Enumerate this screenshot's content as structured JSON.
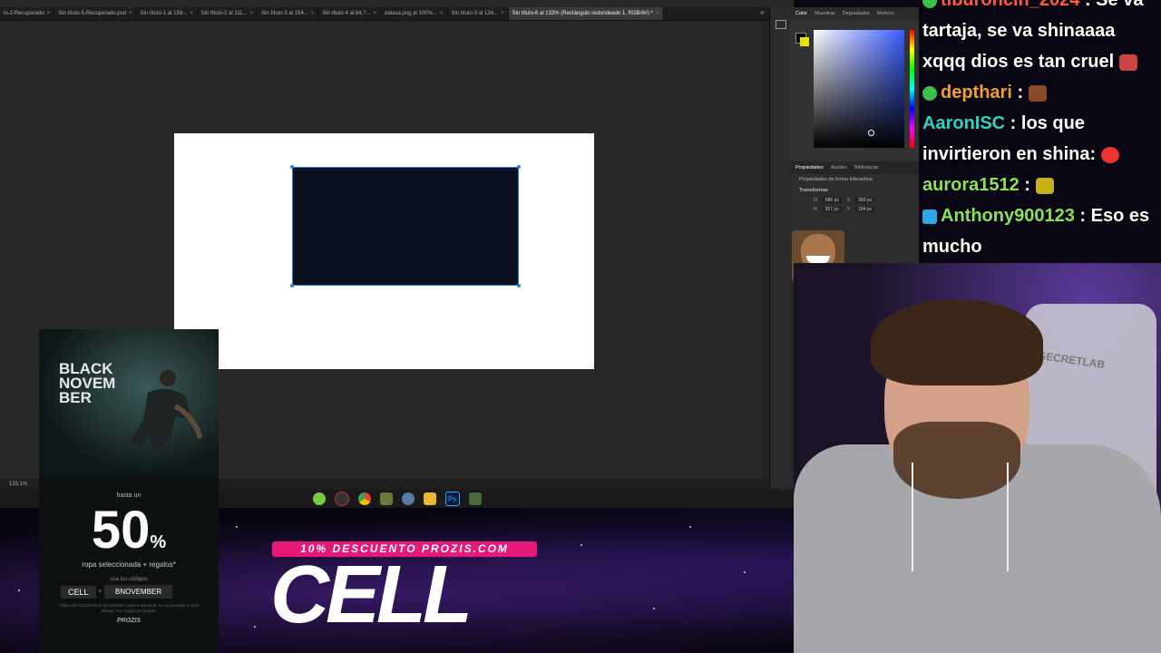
{
  "photoshop": {
    "tabs": [
      {
        "label": "lo-2-Recuperado"
      },
      {
        "label": "Sin título-5-Recuperado.psd"
      },
      {
        "label": "Sin título-1 al 158..."
      },
      {
        "label": "Sin título-2 al 111..."
      },
      {
        "label": "Sin título-3 al 154..."
      },
      {
        "label": "Sin título-4 al 84,7..."
      },
      {
        "label": "dalasa.png al 100%..."
      },
      {
        "label": "Sin título-3 al 134..."
      },
      {
        "label": "Sin título-6 al 133% (Rectángulo redondeado 1, RGB/8#) *"
      }
    ],
    "zoom": "133,1%",
    "color_panel_tabs": [
      "Color",
      "Muestras",
      "Degradados",
      "Motivos"
    ],
    "props_panel_tabs": [
      "Propiedades",
      "Ajustes",
      "Bibliotecas"
    ],
    "props_title": "Propiedades de forma interactiva",
    "transform_label": "Transformar",
    "transform": {
      "w_label": "O",
      "w": "686 px",
      "x_label": "X",
      "x": "360 px",
      "h_label": "H",
      "h": "357 px",
      "y_label": "Y",
      "y": "104 px"
    },
    "colors": {
      "shape_fill": "#0b1020",
      "selection": "#2f7fd6",
      "bg_swatch": "#e8e400"
    }
  },
  "emote_overlay": {
    "count": "x4"
  },
  "chat": {
    "messages": [
      {
        "user": "tiburoncin_2024",
        "text": "Se va tartaja, se va shinaaaa xqqq dios es tan cruel"
      },
      {
        "user": "depthari",
        "text": ""
      },
      {
        "user": "AaronISC",
        "text": "los que invirtieron en shina:"
      },
      {
        "user": "aurora1512",
        "text": ""
      },
      {
        "user": "Anthony900123",
        "text": "Eso es mucho"
      }
    ]
  },
  "webcam": {
    "chair_brand": "SECRETLAB"
  },
  "ad": {
    "title": "BLACK\nNOVEM\nBER",
    "hasta": "hasta un",
    "percent": "50",
    "percent_sign": "%",
    "subtitle": "ropa seleccionada + regalos*",
    "use_codes": "usa los códigos",
    "code1": "CELL",
    "plus": "+",
    "code2": "BNOVEMBER",
    "fine_print": "Válido del 01/11/2025 al 30/11/2025. Hasta 5 artículos. No acumulable a otras ofertas. *Un regalo por pedido.",
    "brand": "PROZIS"
  },
  "promo": {
    "banner": "10% DESCUENTO PROZIS.COM",
    "code": "CELL",
    "banner_color": "#e8187a"
  }
}
